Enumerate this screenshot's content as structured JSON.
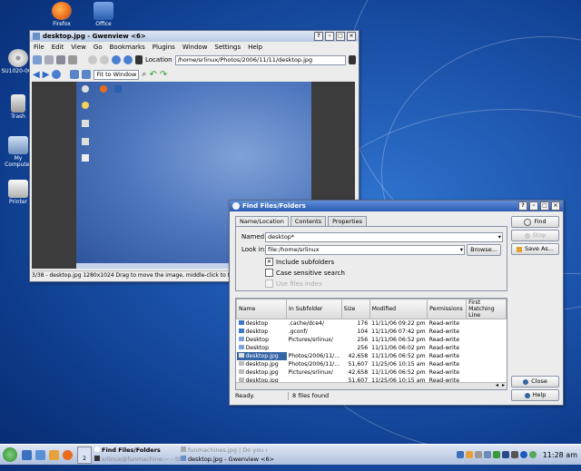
{
  "desktop": {
    "icons": [
      {
        "label": "Firefox",
        "color": "#e96b1c"
      },
      {
        "label": "Office",
        "color": "#2a5fb0"
      },
      {
        "label": "SU1020-001",
        "color": "#dddddd"
      },
      {
        "label": "Trash",
        "color": "#c6c6c6"
      },
      {
        "label": "My Computer",
        "color": "#9fb8d8"
      },
      {
        "label": "Printer",
        "color": "#d8d8d8"
      }
    ]
  },
  "gwenview": {
    "title": "desktop.jpg - Gwenview <6>",
    "menu": [
      "File",
      "Edit",
      "View",
      "Go",
      "Bookmarks",
      "Plugins",
      "Window",
      "Settings",
      "Help"
    ],
    "location_label": "Location",
    "location_value": "/home/srlinux/Photos/2006/11/11/desktop.jpg",
    "zoom_value": "Fit to Window",
    "status": "3/38 - desktop.jpg 1280x1024 Drag to move the image, middle-click to toggle a"
  },
  "find": {
    "title": "Find Files/Folders",
    "tabs": [
      "Name/Location",
      "Contents",
      "Properties"
    ],
    "named_label": "Named:",
    "named_value": "desktop*",
    "lookin_label": "Look in:",
    "lookin_value": "file:/home/srlinux",
    "browse_label": "Browse...",
    "include_subfolders": "Include subfolders",
    "case_sensitive": "Case sensitive search",
    "use_files_index": "Use files index",
    "buttons": {
      "find": "Find",
      "stop": "Stop",
      "save_as": "Save As...",
      "close": "Close",
      "help": "Help"
    },
    "columns": [
      "Name",
      "In Subfolder",
      "Size",
      "Modified",
      "Permissions",
      "First Matching Line"
    ],
    "rows": [
      {
        "name": "desktop",
        "sub": ".cache/dce4/",
        "size": "176",
        "mod": "11/11/06 09:22 pm",
        "perm": "Read-write"
      },
      {
        "name": "desktop",
        "sub": ".gconf/",
        "size": "104",
        "mod": "11/11/06 07:42 pm",
        "perm": "Read-write"
      },
      {
        "name": "Desktop",
        "sub": "Pictures/srlinux/",
        "size": "256",
        "mod": "11/11/06 06:52 pm",
        "perm": "Read-write"
      },
      {
        "name": "Desktop",
        "sub": "",
        "size": "256",
        "mod": "11/11/06 06:02 pm",
        "perm": "Read-write"
      },
      {
        "name": "desktop.jpg",
        "sub": "Photos/2006/11/...",
        "size": "42,658",
        "mod": "11/11/06 06:52 pm",
        "perm": "Read-write"
      },
      {
        "name": "desktop.jpg",
        "sub": "Photos/2006/11/...",
        "size": "51,607",
        "mod": "11/25/06 10:15 am",
        "perm": "Read-write"
      },
      {
        "name": "desktop.jpg",
        "sub": "Pictures/srlinux/",
        "size": "42,658",
        "mod": "11/11/06 06:52 pm",
        "perm": "Read-write"
      },
      {
        "name": "desktop.jpg",
        "sub": "",
        "size": "51,607",
        "mod": "11/25/06 10:15 am",
        "perm": "Read-write"
      }
    ],
    "status_left": "Ready.",
    "status_right": "8 files found"
  },
  "taskbar": {
    "desktop_number": "2",
    "tasks": [
      {
        "label": "Find Files/Folders",
        "bold": true
      },
      {
        "label": "srlinux@funmachine:~ - Shell",
        "bold": false
      },
      {
        "label": "funmachines.jpg | Do you wan",
        "bold": false
      },
      {
        "label": "desktop.jpg - Gwenview <6>",
        "bold": false
      }
    ],
    "clock": "11:28 am"
  },
  "colors": {
    "accent": "#3465a4",
    "titlebar_blue": "#2c5ab4"
  }
}
